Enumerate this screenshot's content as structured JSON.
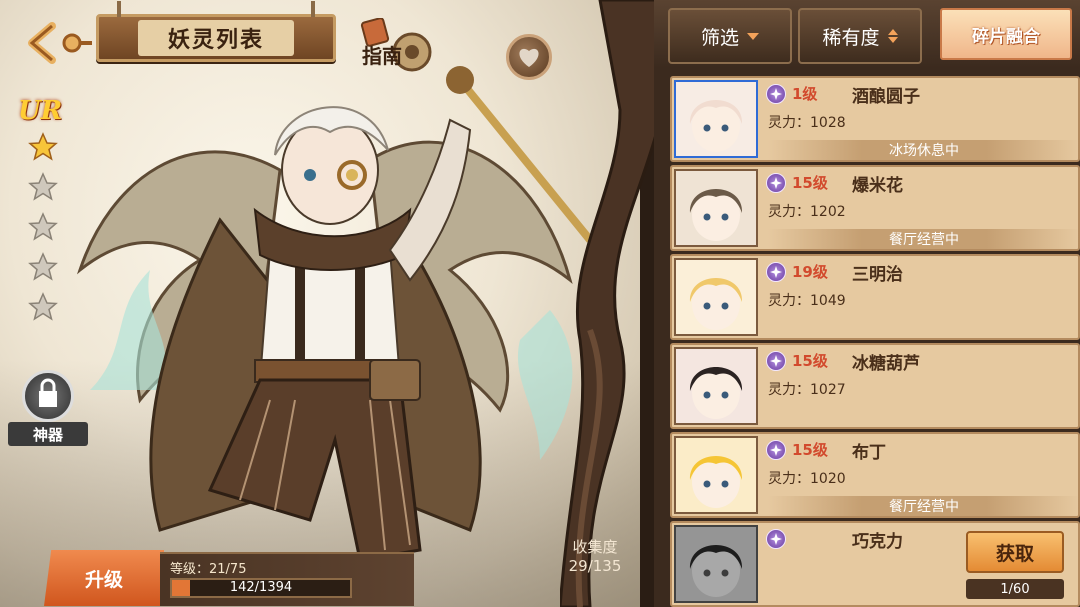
{
  "header": {
    "title": "妖灵列表",
    "guide_label": "指南"
  },
  "character": {
    "rarity": "UR",
    "stars_filled": 1,
    "stars_total": 5,
    "artifact_label": "神器",
    "level_text": "等级：21/75",
    "exp_current": 142,
    "exp_max": 1394,
    "exp_text": "142/1394",
    "upgrade_label": "升级"
  },
  "collection": {
    "label": "收集度",
    "value": "29/135"
  },
  "controls": {
    "filter_label": "筛选",
    "sort_label": "稀有度",
    "fuse_label": "碎片融合"
  },
  "spirits": [
    {
      "level": "1级",
      "name": "酒酿圆子",
      "power": "灵力：1028",
      "status": "冰场休息中",
      "selected": true,
      "portrait_color": "#f7ece4",
      "hair": "#f1dcd0"
    },
    {
      "level": "15级",
      "name": "爆米花",
      "power": "灵力：1202",
      "status": "餐厅经营中",
      "selected": false,
      "portrait_color": "#efe3d4",
      "hair": "#6b5a48"
    },
    {
      "level": "19级",
      "name": "三明治",
      "power": "灵力：1049",
      "status": "",
      "selected": false,
      "portrait_color": "#fbefd8",
      "hair": "#f0c86a"
    },
    {
      "level": "15级",
      "name": "冰糖葫芦",
      "power": "灵力：1027",
      "status": "",
      "selected": false,
      "portrait_color": "#f4e6e0",
      "hair": "#2b2322"
    },
    {
      "level": "15级",
      "name": "布丁",
      "power": "灵力：1020",
      "status": "餐厅经营中",
      "selected": false,
      "portrait_color": "#fbecc8",
      "hair": "#f5c535"
    },
    {
      "level": "",
      "name": "巧克力",
      "power": "",
      "status": "",
      "selected": false,
      "locked": true,
      "portrait_color": "#d5d5d5",
      "hair": "#2a2a2a",
      "obtain_label": "获取",
      "fragments": "1/60"
    }
  ]
}
